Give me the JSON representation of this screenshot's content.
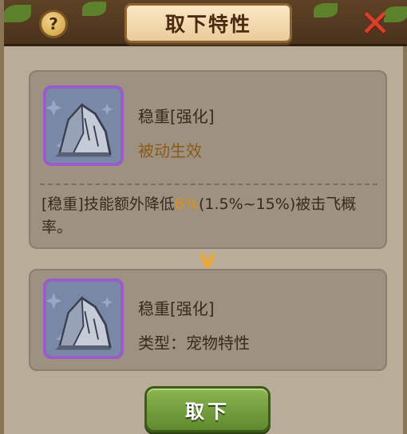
{
  "header": {
    "title": "取下特性",
    "help_label": "?",
    "close_label": "✕"
  },
  "equipped_trait": {
    "name": "稳重[强化]",
    "effect": "被动生效",
    "description_prefix": "[稳重]技能额外降低",
    "description_highlight": "6%",
    "description_suffix": "(1.5%~15%)被击飞概率。"
  },
  "replacement_trait": {
    "name": "稳重[强化]",
    "type": "类型：宠物特性"
  },
  "actions": {
    "take_off_label": "取下"
  },
  "colors": {
    "highlight": "#e0901a",
    "effect_text": "#8a5a1a",
    "icon_border": "#9a5cc9",
    "button_green": "#6f9a3c",
    "close_red": "#d8402a"
  }
}
